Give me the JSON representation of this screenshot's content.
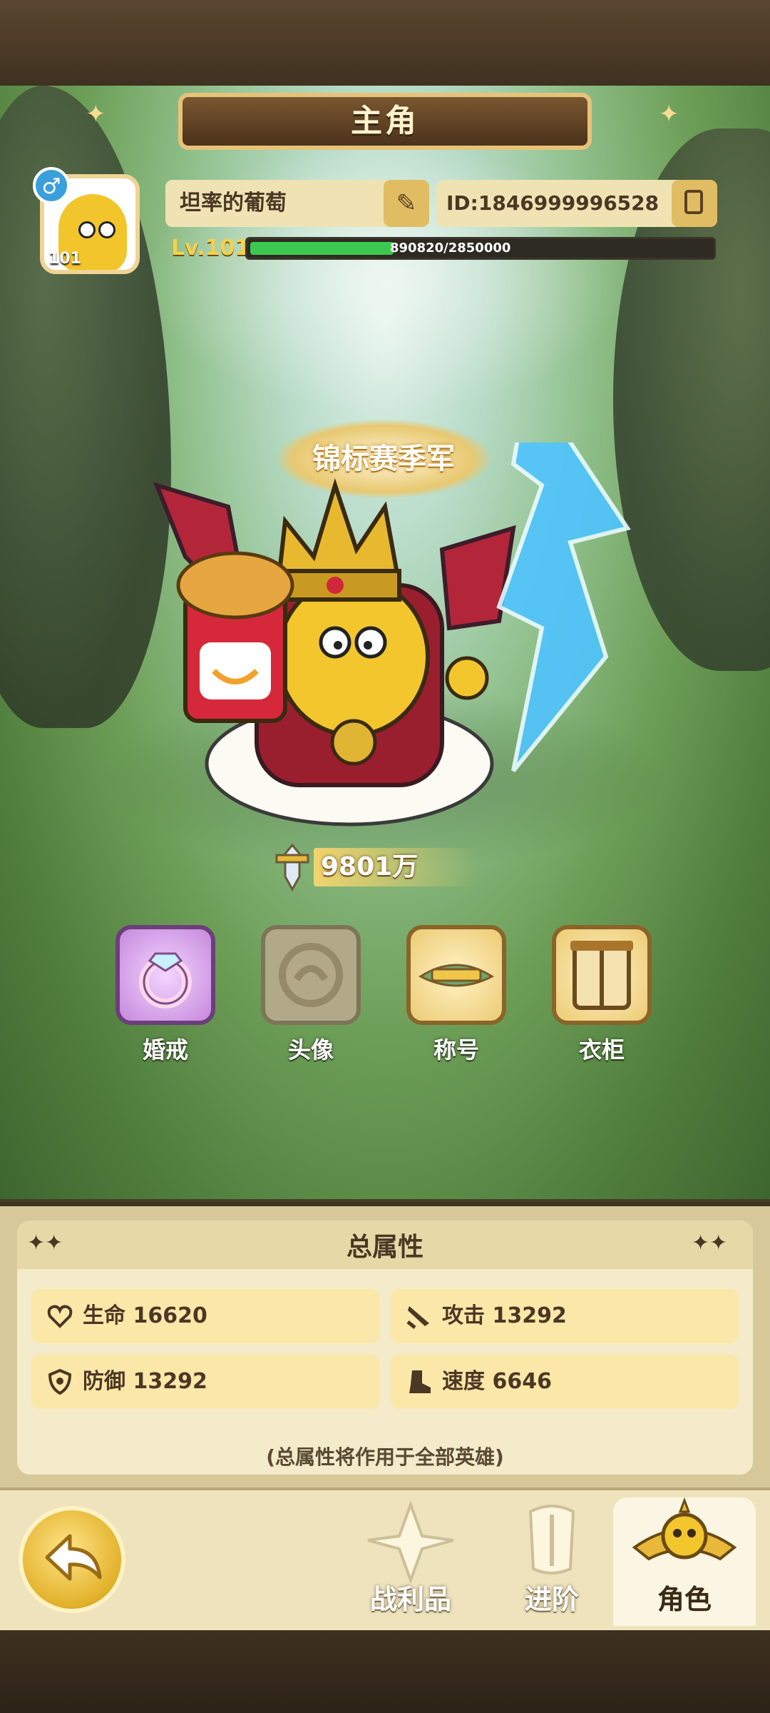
{
  "header": {
    "title": "主角"
  },
  "profile": {
    "avatar_level": "101",
    "gender_symbol": "♂",
    "name": "坦率的葡萄",
    "id_text": "ID:1846999996528",
    "level_label": "Lv.101",
    "exp_text": "890820/2850000",
    "exp_progress": 0.3126
  },
  "title_badge": {
    "text": "锦标赛季军"
  },
  "power": {
    "value": "9801万"
  },
  "shortcuts": [
    {
      "label": "婚戒",
      "icon": "ring-icon"
    },
    {
      "label": "头像",
      "icon": "avatar-frame-icon"
    },
    {
      "label": "称号",
      "icon": "title-icon"
    },
    {
      "label": "衣柜",
      "icon": "wardrobe-icon"
    }
  ],
  "attributes": {
    "title": "总属性",
    "items": [
      {
        "label": "生命 16620",
        "icon": "heart-icon"
      },
      {
        "label": "攻击 13292",
        "icon": "attack-icon"
      },
      {
        "label": "防御 13292",
        "icon": "shield-icon"
      },
      {
        "label": "速度 6646",
        "icon": "boot-icon"
      }
    ],
    "note": "(总属性将作用于全部英雄)"
  },
  "nav": {
    "items": [
      {
        "label": "战利品",
        "icon": "loot-icon",
        "active": false
      },
      {
        "label": "进阶",
        "icon": "advance-icon",
        "active": false
      },
      {
        "label": "角色",
        "icon": "character-icon",
        "active": true
      }
    ]
  },
  "colors": {
    "exp_bar": "#3cc850",
    "accent_gold": "#e0bd63",
    "panel_bg": "#f3ebc9"
  }
}
